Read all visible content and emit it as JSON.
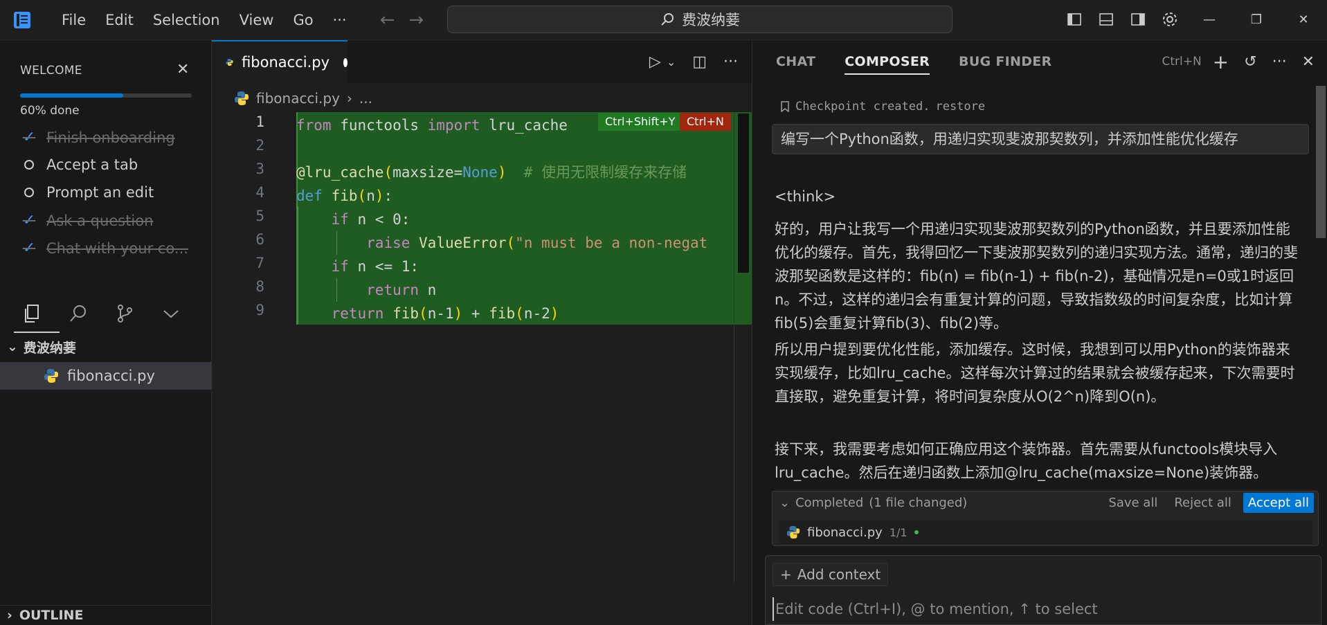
{
  "titlebar": {
    "menu": [
      "File",
      "Edit",
      "Selection",
      "View",
      "Go",
      "···"
    ],
    "search_text": "费波纳菨"
  },
  "welcome": {
    "title": "WELCOME",
    "progress_label": "60% done",
    "progress": 0.6,
    "items": [
      {
        "label": "Finish onboarding",
        "done": true
      },
      {
        "label": "Accept a tab",
        "done": false
      },
      {
        "label": "Prompt an edit",
        "done": false
      },
      {
        "label": "Ask a question",
        "done": true
      },
      {
        "label": "Chat with your co...",
        "done": true
      }
    ]
  },
  "explorer": {
    "folder": "费波纳菨",
    "file": "fibonacci.py",
    "outline": "OUTLINE"
  },
  "editor": {
    "tab_label": "fibonacci.py",
    "breadcrumb_file": "fibonacci.py",
    "breadcrumb_rest": "...",
    "badge_accept": "Ctrl+Shift+Y",
    "badge_reject": "Ctrl+N",
    "line_numbers": [
      "1",
      "2",
      "3",
      "4",
      "5",
      "6",
      "7",
      "8",
      "9"
    ]
  },
  "chat": {
    "tabs": [
      "CHAT",
      "COMPOSER",
      "BUG FINDER"
    ],
    "active_tab": "COMPOSER",
    "new_shortcut": "Ctrl+N",
    "checkpoint_text": "Checkpoint created.",
    "checkpoint_restore": "restore",
    "user_message": "编写一个Python函数，用递归实现斐波那契数列，并添加性能优化缓存",
    "think_tag": "<think>",
    "paragraphs": [
      "好的，用户让我写一个用递归实现斐波那契数列的Python函数，并且要添加性能优化的缓存。首先，我得回忆一下斐波那契数列的递归实现方法。通常，递归的斐波那契函数是这样的：fib(n) = fib(n-1) + fib(n-2)，基础情况是n=0或1时返回n。不过，这样的递归会有重复计算的问题，导致指数级的时间复杂度，比如计算fib(5)会重复计算fib(3)、fib(2)等。",
      "所以用户提到要优化性能，添加缓存。这时候，我想到可以用Python的装饰器来实现缓存，比如lru_cache。这样每次计算过的结果就会被缓存起来，下次需要时直接取，避免重复计算，将时间复杂度从O(2^n)降到O(n)。",
      "接下来，我需要考虑如何正确应用这个装饰器。首先需要从functools模块导入lru_cache。然后在递归函数上添加@lru_cache(maxsize=None)装饰器。maxsize=None表示缓存大小无限制，这样所有结果都会被缓存。"
    ],
    "changes_header": "Completed",
    "changes_count": "(1 file changed)",
    "save_all": "Save all",
    "reject_all": "Reject all",
    "accept_all": "Accept all",
    "changed_file": "fibonacci.py",
    "changed_file_count": "1/1",
    "add_context": "Add context",
    "input_placeholder": "Edit code (Ctrl+I), @ to mention, ↑ to select"
  },
  "colors": {
    "accent": "#0078d4",
    "diff_added_bg": "#1f5c22",
    "reject_badge": "#a1260d",
    "accept_badge": "#1f7a22"
  }
}
